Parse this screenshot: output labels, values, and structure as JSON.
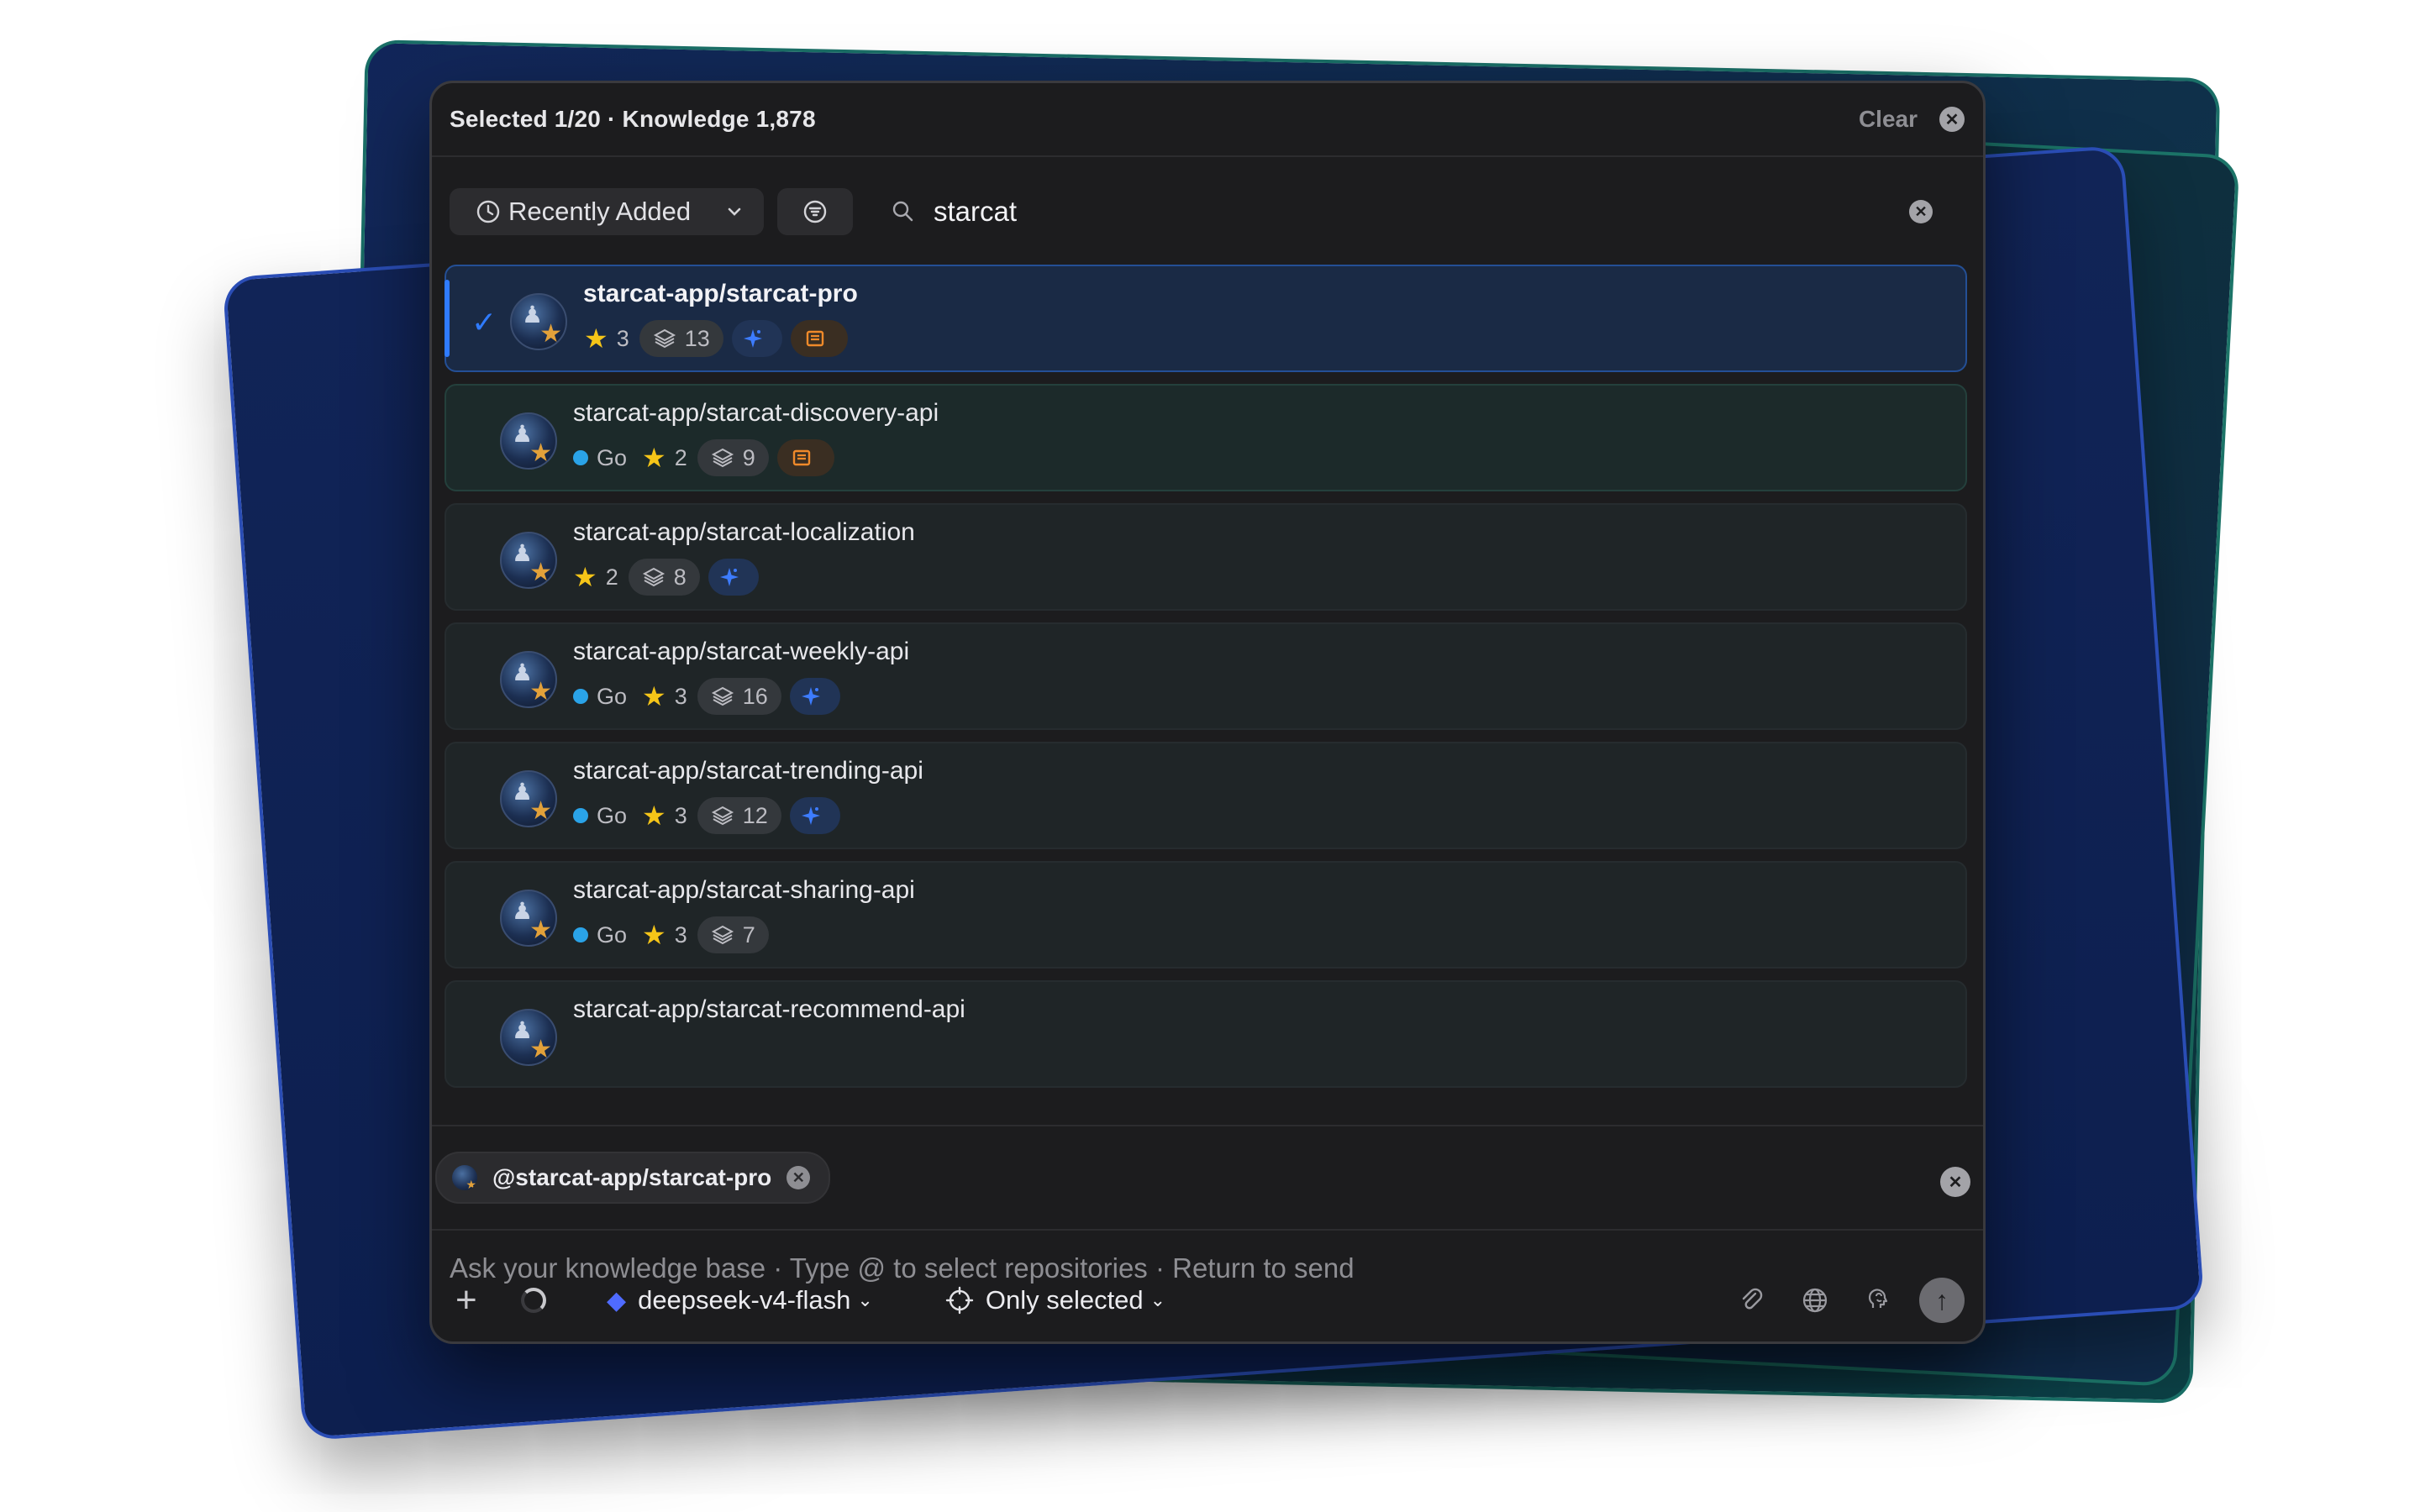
{
  "header": {
    "title": "Selected 1/20 · Knowledge 1,878",
    "clear_label": "Clear"
  },
  "toolbar": {
    "sort_label": "Recently Added",
    "search_value": "starcat"
  },
  "repos": [
    {
      "name": "starcat-app/starcat-pro",
      "selected": true,
      "lang": null,
      "stars": "3",
      "docs": "13",
      "ai": true,
      "doc_badge": true
    },
    {
      "name": "starcat-app/starcat-discovery-api",
      "selected": false,
      "lang": "Go",
      "stars": "2",
      "docs": "9",
      "ai": false,
      "doc_badge": true
    },
    {
      "name": "starcat-app/starcat-localization",
      "selected": false,
      "lang": null,
      "stars": "2",
      "docs": "8",
      "ai": true,
      "doc_badge": false
    },
    {
      "name": "starcat-app/starcat-weekly-api",
      "selected": false,
      "lang": "Go",
      "stars": "3",
      "docs": "16",
      "ai": true,
      "doc_badge": false
    },
    {
      "name": "starcat-app/starcat-trending-api",
      "selected": false,
      "lang": "Go",
      "stars": "3",
      "docs": "12",
      "ai": true,
      "doc_badge": false
    },
    {
      "name": "starcat-app/starcat-sharing-api",
      "selected": false,
      "lang": "Go",
      "stars": "3",
      "docs": "7",
      "ai": false,
      "doc_badge": false
    },
    {
      "name": "starcat-app/starcat-recommend-api",
      "selected": false,
      "lang": null,
      "stars": null,
      "docs": null,
      "ai": false,
      "doc_badge": false
    }
  ],
  "chip": {
    "label": "@starcat-app/starcat-pro"
  },
  "composer": {
    "placeholder": "Ask your knowledge base · Type @ to select repositories · Return to send",
    "model": "deepseek-v4-flash",
    "scope": "Only selected"
  },
  "colors": {
    "accent": "#2f7bff",
    "star": "#f5c518",
    "go_lang": "#2aa3e8"
  }
}
